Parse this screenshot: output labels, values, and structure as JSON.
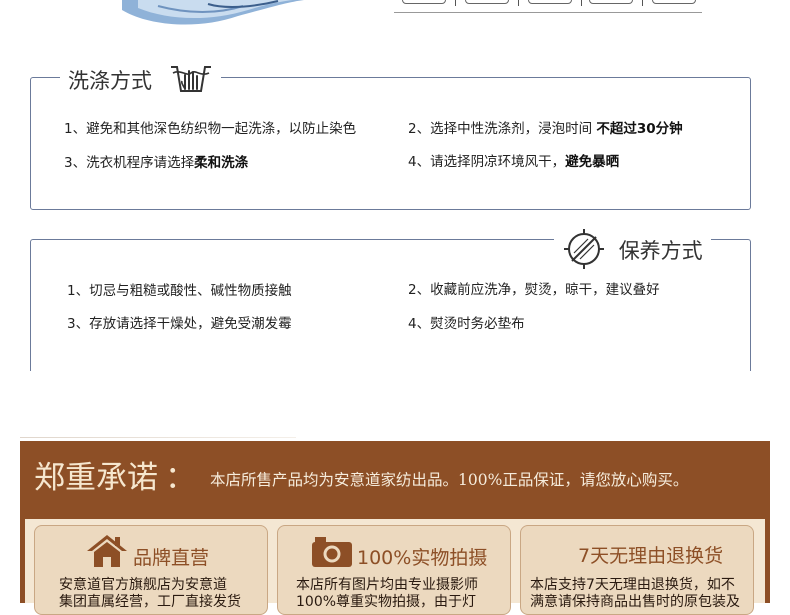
{
  "wash": {
    "title": "洗涤方式",
    "items": [
      {
        "text": "1、避免和其他深色纺织物一起洗涤，以防止染色",
        "bold": ""
      },
      {
        "text": "2、选择中性洗涤剂，浸泡时间 ",
        "bold": "不超过30分钟"
      },
      {
        "text": "3、洗衣机程序请选择",
        "bold": "柔和洗涤"
      },
      {
        "text": "4、请选择阴凉环境风干，",
        "bold": "避免暴晒"
      }
    ]
  },
  "care": {
    "title": "保养方式",
    "items": [
      {
        "text": "1、切忌与粗糙或酸性、碱性物质接触"
      },
      {
        "text": "2、收藏前应洗净，熨烫，晾干，建议叠好"
      },
      {
        "text": "3、存放请选择干燥处，避免受潮发霉"
      },
      {
        "text": "4、熨烫时务必垫布"
      }
    ]
  },
  "promise": {
    "title": "郑重承诺",
    "colon": "：",
    "text": "本店所售产品均为安意道家纺出品。100%正品保证，请您放心购买。",
    "cards": [
      {
        "icon": "house-icon",
        "title": "品牌直营",
        "lines": [
          "安意道官方旗舰店为安意道",
          "集团直属经营，工厂直接发货"
        ]
      },
      {
        "icon": "camera-icon",
        "title": "100%实物拍摄",
        "lines": [
          "本店所有图片均由专业摄影师",
          "100%尊重实物拍摄，由于灯"
        ]
      },
      {
        "icon": "",
        "title": "7天无理由退换货",
        "lines": [
          "本店支持7天无理由退换货，如不",
          "满意请保持商品出售时的原包装及"
        ]
      }
    ]
  },
  "colors": {
    "box_border": "#6b7a9a",
    "banner_bg": "#8d4f26",
    "banner_inner": "#f4e7d3",
    "card_bg": "#ecd9bf",
    "card_title": "#8d4f26"
  }
}
